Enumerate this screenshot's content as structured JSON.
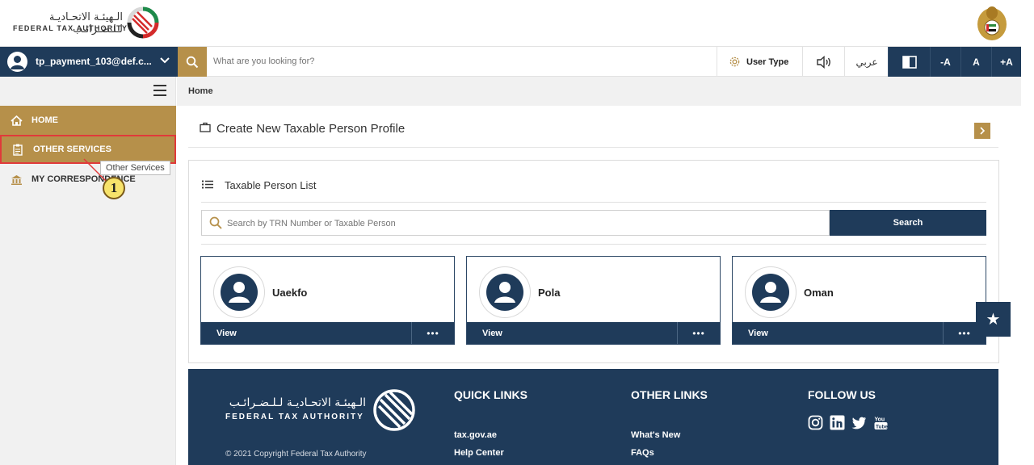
{
  "header": {
    "logo_arabic": "الـهيئـة الاتحـاديـة لـلـضـرائـب",
    "logo_english": "FEDERAL TAX AUTHORITY"
  },
  "topbar": {
    "user_email": "tp_payment_103@def.c...",
    "search_placeholder": "What are you looking for?",
    "user_type_label": "User Type",
    "language_label": "عربي",
    "font_decrease": "-A",
    "font_normal": "A",
    "font_increase": "+A"
  },
  "sidebar": {
    "items": [
      {
        "label": "HOME",
        "icon": "home-icon",
        "active": true
      },
      {
        "label": "OTHER SERVICES",
        "icon": "clipboard-icon",
        "active": true
      },
      {
        "label": "MY CORRESPONDENCE",
        "icon": "bank-icon",
        "active": false
      }
    ],
    "tooltip": "Other Services",
    "step_marker": "1"
  },
  "breadcrumb": {
    "current": "Home"
  },
  "main": {
    "create_title": "Create New Taxable Person Profile",
    "list_title": "Taxable Person List",
    "search_placeholder": "Search by TRN Number or Taxable Person",
    "search_button": "Search",
    "cards": [
      {
        "name": "Uaekfo",
        "view_label": "View",
        "more_label": "•••"
      },
      {
        "name": "Pola",
        "view_label": "View",
        "more_label": "•••"
      },
      {
        "name": "Oman",
        "view_label": "View",
        "more_label": "•••"
      }
    ]
  },
  "footer": {
    "logo_arabic": "الـهيئـة الاتحـاديـة لـلـضـرائـب",
    "logo_english": "FEDERAL TAX AUTHORITY",
    "copyright": "© 2021 Copyright Federal Tax Authority",
    "quick_links_title": "QUICK LINKS",
    "quick_links": [
      "tax.gov.ae",
      "Help Center"
    ],
    "other_links_title": "OTHER LINKS",
    "other_links": [
      "What's New",
      "FAQs"
    ],
    "follow_title": "FOLLOW US",
    "social": [
      "instagram-icon",
      "linkedin-icon",
      "twitter-icon",
      "youtube-icon"
    ]
  },
  "colors": {
    "navy": "#1f3b5a",
    "gold": "#b6904a",
    "highlight_red": "#e03a3a",
    "marker_yellow": "#f7e36b"
  }
}
